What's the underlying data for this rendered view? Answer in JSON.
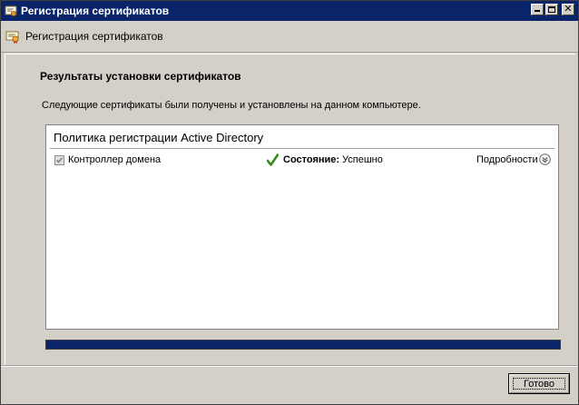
{
  "window": {
    "title": "Регистрация сертификатов",
    "icon": "certificate-icon"
  },
  "header": {
    "title": "Регистрация сертификатов",
    "icon": "certificate-icon"
  },
  "main": {
    "section_title": "Результаты установки сертификатов",
    "description": "Следующие сертификаты были получены и установлены на данном компьютере.",
    "policy": {
      "name": "Политика регистрации Active Directory",
      "items": [
        {
          "label": "Контроллер домена",
          "checked": true,
          "status_label": "Состояние:",
          "status_value": "Успешно",
          "details": "Подробности"
        }
      ]
    },
    "progress": 1.0
  },
  "footer": {
    "done_label": "Готово"
  },
  "colors": {
    "titlebar": "#0a246a",
    "background": "#d4d0c8",
    "success": "#3a8a1c"
  }
}
